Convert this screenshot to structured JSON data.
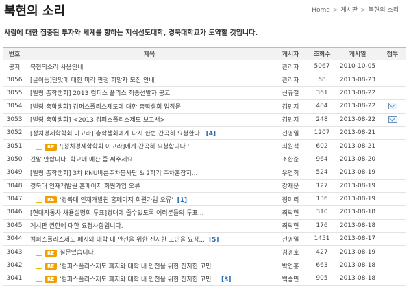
{
  "header": {
    "title": "북현의 소리",
    "breadcrumb": [
      "Home",
      "게시판",
      "북현의 소리"
    ],
    "slogan": "사람에 대한 집중된 투자와 세계를 향하는 지식선도대학, 경북대학교가 도약할 것입니다."
  },
  "table": {
    "columns": [
      "번호",
      "제목",
      "게시자",
      "조회수",
      "게시일",
      "첨부"
    ],
    "rows": [
      {
        "num": "공지",
        "title": "북현의소리 사용안내",
        "comments": "",
        "reply": false,
        "author": "관리자",
        "views": "5067",
        "date": "2010-10-05",
        "attach": false
      },
      {
        "num": "3056",
        "title": "[글이동]단맛에 대한 미각 판정 희망자 모집 안내",
        "comments": "",
        "reply": false,
        "author": "관리자",
        "views": "68",
        "date": "2013-08-23",
        "attach": false
      },
      {
        "num": "3055",
        "title": "[빌링 총학생회] 2013 컴퍼스 폴리스 최종선발자 공고",
        "comments": "",
        "reply": false,
        "author": "신규철",
        "views": "361",
        "date": "2013-08-22",
        "attach": false
      },
      {
        "num": "3054",
        "title": "[빌링 총학생회] 컴퍼스폴리스제도에 대한 총학생회 입장문",
        "comments": "",
        "reply": false,
        "author": "김민지",
        "views": "484",
        "date": "2013-08-22",
        "attach": true
      },
      {
        "num": "3053",
        "title": "[빌링 총학생회] <2013 컴퍼스폴리스제도 보고서>",
        "comments": "",
        "reply": false,
        "author": "김민지",
        "views": "248",
        "date": "2013-08-22",
        "attach": true
      },
      {
        "num": "3052",
        "title": "[정치경제학학회 아고라] 총학생회에게 다시 한번 간곡히 요청한다.",
        "comments": "[4]",
        "reply": false,
        "author": "전영일",
        "views": "1207",
        "date": "2013-08-21",
        "attach": false
      },
      {
        "num": "3051",
        "title": "'[정치경제학학회 아고라]에게 간곡히 요청합니다.'",
        "comments": "",
        "reply": true,
        "author": "최원석",
        "views": "602",
        "date": "2013-08-21",
        "attach": false
      },
      {
        "num": "3050",
        "title": "긴말 안합니다. 학교에 예산 좀 써주세요.",
        "comments": "",
        "reply": false,
        "author": "조한준",
        "views": "964",
        "date": "2013-08-20",
        "attach": false
      },
      {
        "num": "3049",
        "title": "[빌링 총학생회] 3차 KNU바른주차봉사단 & 2학기 주차혼잡지...",
        "comments": "",
        "reply": false,
        "author": "우연희",
        "views": "524",
        "date": "2013-08-19",
        "attach": false
      },
      {
        "num": "3048",
        "title": "경북대 인재개발원 홈페이지 회원가입 오류",
        "comments": "",
        "reply": false,
        "author": "강재운",
        "views": "127",
        "date": "2013-08-19",
        "attach": false
      },
      {
        "num": "3047",
        "title": "'경북대 인재개발원 홈페이지 회원가입 오류'",
        "comments": "[1]",
        "reply": true,
        "author": "정미리",
        "views": "136",
        "date": "2013-08-19",
        "attach": false
      },
      {
        "num": "3046",
        "title": "[현대자동차 채용설명회 투표]경대에 줄수있도록 여러분들의 투표...",
        "comments": "",
        "reply": false,
        "author": "최락현",
        "views": "310",
        "date": "2013-08-18",
        "attach": false
      },
      {
        "num": "3045",
        "title": "게시판 권한에 대한 요청사항입니다.",
        "comments": "",
        "reply": false,
        "author": "최락현",
        "views": "176",
        "date": "2013-08-18",
        "attach": false
      },
      {
        "num": "3044",
        "title": "컴퍼스폴리스제도 폐지와 대학 내 안전을 위한 진지한 고민을 요청...",
        "comments": "[5]",
        "reply": false,
        "author": "전영일",
        "views": "1451",
        "date": "2013-08-17",
        "attach": false
      },
      {
        "num": "3043",
        "title": "질문있습니다.",
        "comments": "",
        "reply": true,
        "author": "김경호",
        "views": "427",
        "date": "2013-08-19",
        "attach": false
      },
      {
        "num": "3042",
        "title": "'컴퍼스폴리스제도 폐지와 대학 내 안전을 위한 진지한 고민...",
        "comments": "",
        "reply": true,
        "author": "박연홍",
        "views": "663",
        "date": "2013-08-18",
        "attach": false
      },
      {
        "num": "3041",
        "title": "'컴퍼스폴리스제도 폐지와 대학 내 안전을 위한 진지한 고민...",
        "comments": "[3]",
        "reply": true,
        "author": "백승민",
        "views": "905",
        "date": "2013-08-18",
        "attach": false
      }
    ]
  },
  "icons": {
    "reply": "re-badge",
    "attachment": "mail-icon"
  },
  "colors": {
    "reply_badge": "#f0a000",
    "comment_count": "#2b6cb0",
    "header_bg": "#f2f2f2"
  }
}
